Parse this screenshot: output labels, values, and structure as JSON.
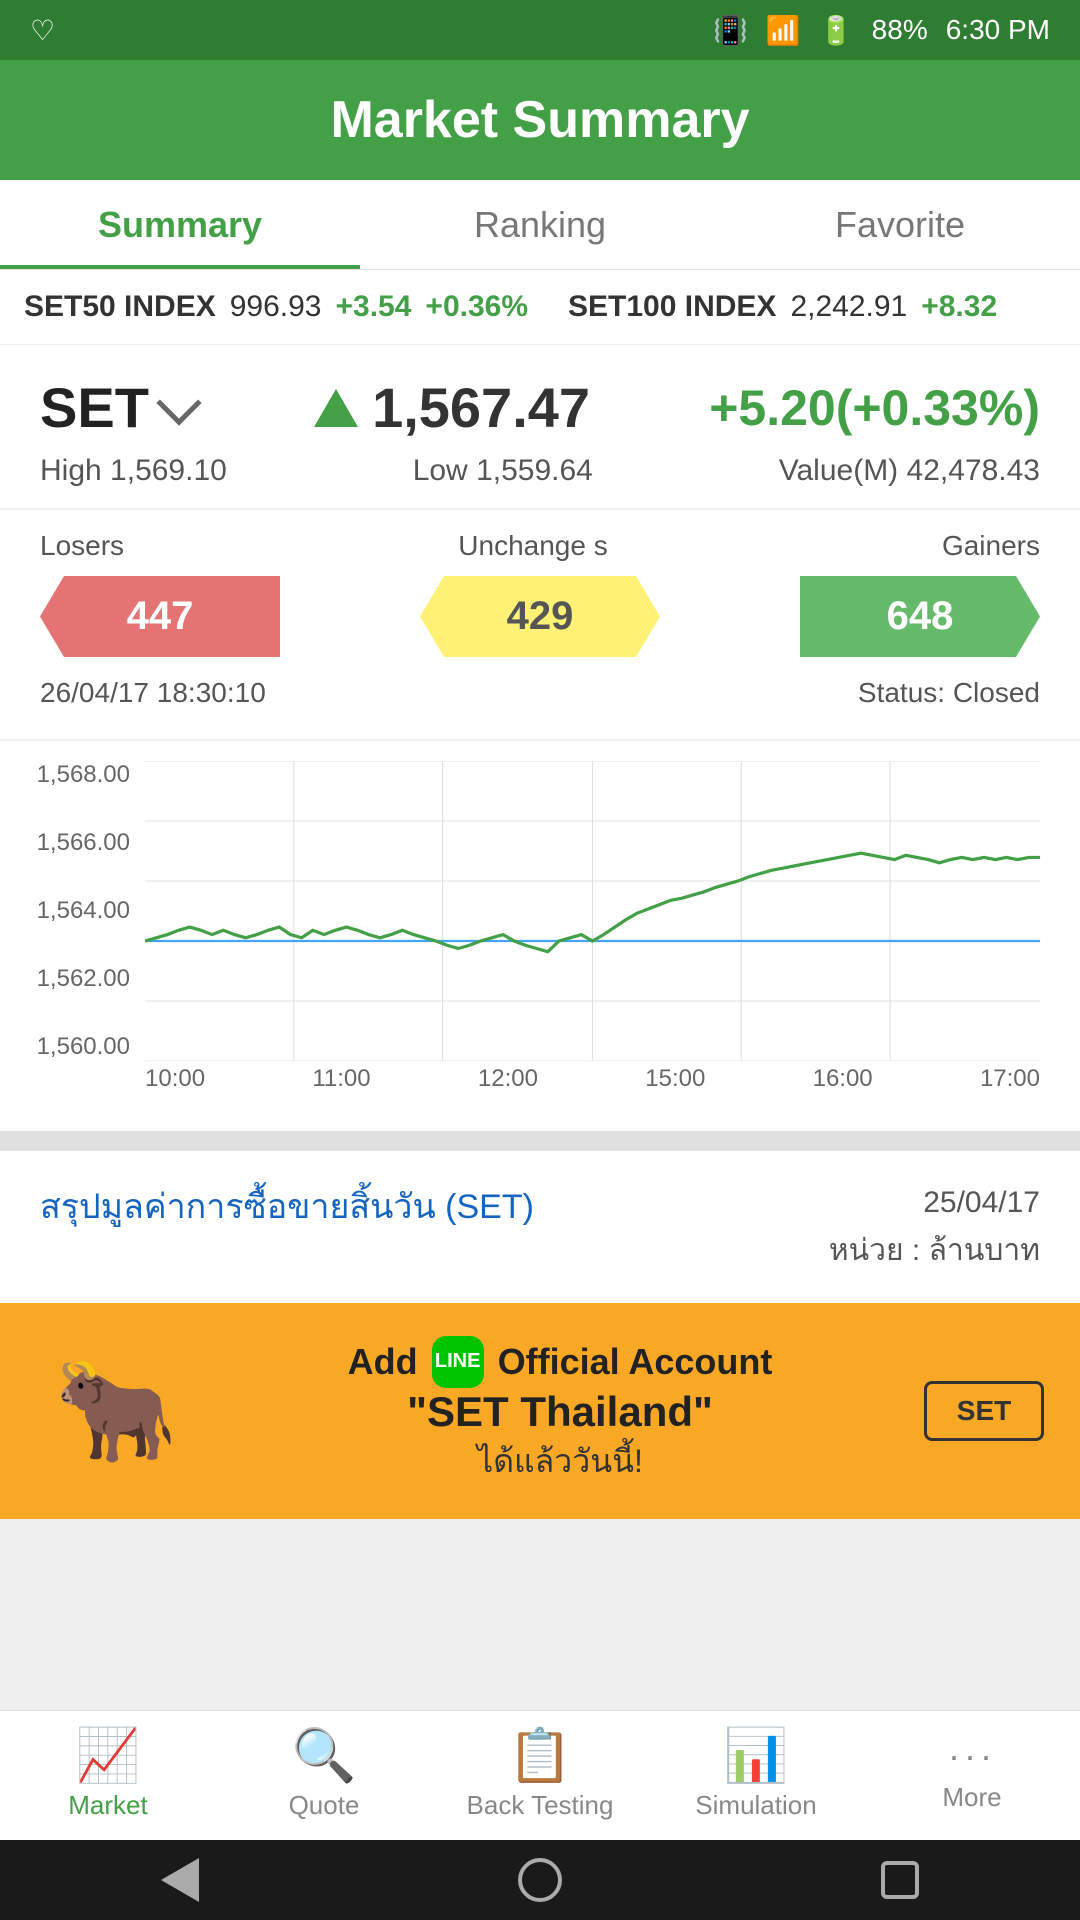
{
  "statusBar": {
    "battery": "88%",
    "time": "6:30 PM"
  },
  "header": {
    "title": "Market Summary"
  },
  "tabs": [
    {
      "id": "summary",
      "label": "Summary",
      "active": true
    },
    {
      "id": "ranking",
      "label": "Ranking",
      "active": false
    },
    {
      "id": "favorite",
      "label": "Favorite",
      "active": false
    }
  ],
  "ticker": [
    {
      "name": "SET50 INDEX",
      "value": "996.93",
      "change": "+3.54",
      "changePct": "+0.36%"
    },
    {
      "name": "SET100 INDEX",
      "value": "2,242.91",
      "change": "+8.32",
      "changePct": ""
    }
  ],
  "index": {
    "name": "SET",
    "price": "1,567.47",
    "change": "+5.20(+0.33%)",
    "high": "1,569.10",
    "low": "1,559.64",
    "valueM": "42,478.43"
  },
  "marketStats": {
    "losersLabel": "Losers",
    "unchangedLabel": "Unchange s",
    "gainersLabel": "Gainers",
    "losers": "447",
    "unchanged": "429",
    "gainers": "648",
    "timestamp": "26/04/17 18:30:10",
    "status": "Status: Closed"
  },
  "chart": {
    "yLabels": [
      "1,568.00",
      "1,566.00",
      "1,564.00",
      "1,562.00",
      "1,560.00"
    ],
    "xLabels": [
      "10:00",
      "11:00",
      "12:00",
      "15:00",
      "16:00",
      "17:00"
    ],
    "baselineLabel": "1,562.00"
  },
  "infoSection": {
    "linkText": "สรุปมูลค่าการซื้อขายสิ้นวัน (SET)",
    "date": "25/04/17",
    "unit": "หน่วย : ล้านบาท"
  },
  "banner": {
    "line1": "Add",
    "lineIcon": "LINE",
    "line2": "Official Account",
    "quote": "\"SET Thailand\"",
    "suffix": "ได้แล้ววันนี้!",
    "setLabel": "SET"
  },
  "bottomNav": [
    {
      "id": "market",
      "label": "Market",
      "icon": "📈",
      "active": true
    },
    {
      "id": "quote",
      "label": "Quote",
      "icon": "🔍",
      "active": false
    },
    {
      "id": "backtesting",
      "label": "Back Testing",
      "icon": "📋",
      "active": false
    },
    {
      "id": "simulation",
      "label": "Simulation",
      "icon": "📊",
      "active": false
    },
    {
      "id": "more",
      "label": "More",
      "icon": "···",
      "active": false
    }
  ]
}
